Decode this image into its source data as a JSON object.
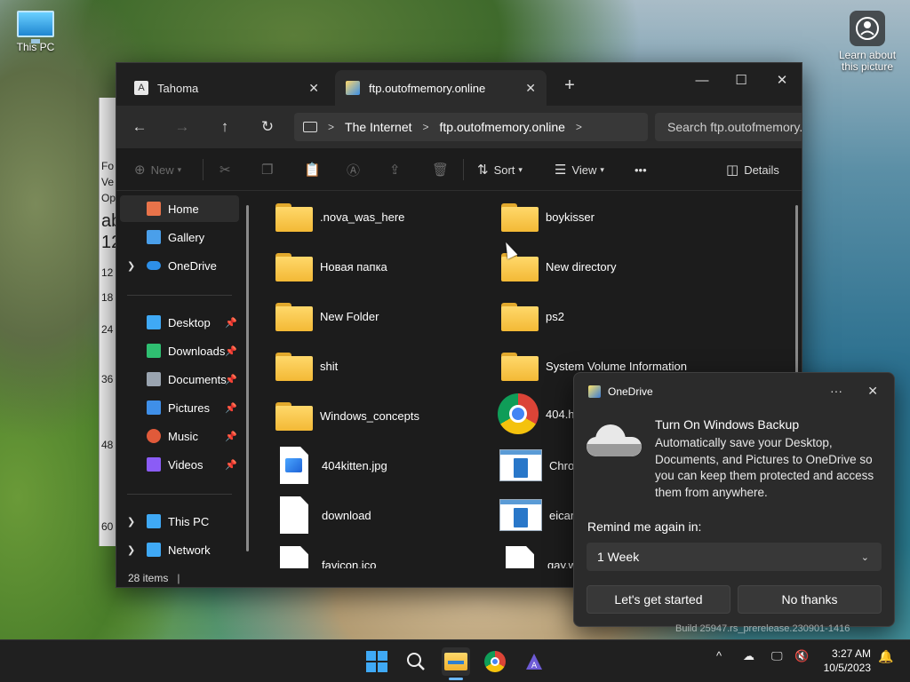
{
  "desktop": {
    "icons": [
      {
        "label": "This PC"
      },
      {
        "label": "Learn about this picture"
      }
    ]
  },
  "background_window": {
    "lines": [
      "Fo",
      "Ve",
      "Op",
      "ab",
      "12",
      "12",
      "18",
      "24",
      "36",
      "48",
      "60"
    ]
  },
  "explorer": {
    "tabs": [
      {
        "label": "Tahoma",
        "active": false
      },
      {
        "label": "ftp.outofmemory.online",
        "active": true
      }
    ],
    "new_tab": "+",
    "window_controls": {
      "minimize": "—",
      "maximize": "☐",
      "close": "✕"
    },
    "nav": {
      "back": "←",
      "forward": "→",
      "up": "↑",
      "refresh": "↻"
    },
    "address": {
      "crumbs": [
        "The Internet",
        "ftp.outofmemory.online"
      ],
      "sep": ">"
    },
    "search": {
      "placeholder": "Search ftp.outofmemory."
    },
    "toolbar": {
      "new_label": "New",
      "sort_label": "Sort",
      "view_label": "View",
      "more_label": "•••",
      "details_label": "Details"
    },
    "sidebar": {
      "items": [
        {
          "label": "Home",
          "icon": "home-icon",
          "color": "#e8734a",
          "selected": true
        },
        {
          "label": "Gallery",
          "icon": "gallery-icon",
          "color": "#4a9fea"
        },
        {
          "label": "OneDrive",
          "icon": "onedrive-icon",
          "color": "#2d8fe8",
          "expand": true
        },
        {
          "label": "Desktop",
          "icon": "desktop-icon",
          "color": "#3fa9f5",
          "pinned": true
        },
        {
          "label": "Downloads",
          "icon": "download-icon",
          "color": "#2fbf71",
          "pinned": true
        },
        {
          "label": "Documents",
          "icon": "documents-icon",
          "color": "#9aa4b0",
          "pinned": true
        },
        {
          "label": "Pictures",
          "icon": "pictures-icon",
          "color": "#3f8fe8",
          "pinned": true
        },
        {
          "label": "Music",
          "icon": "music-icon",
          "color": "#e05a3a",
          "pinned": true
        },
        {
          "label": "Videos",
          "icon": "videos-icon",
          "color": "#8b5cf6",
          "pinned": true
        },
        {
          "label": "This PC",
          "icon": "this-pc-icon",
          "color": "#3fa9f5",
          "expand": true
        },
        {
          "label": "Network",
          "icon": "network-icon",
          "color": "#3fa9f5",
          "expand": true
        }
      ]
    },
    "files": [
      {
        "name": ".nova_was_here",
        "type": "folder"
      },
      {
        "name": "boykisser",
        "type": "folder"
      },
      {
        "name": "Новая папка",
        "type": "folder"
      },
      {
        "name": "New directory",
        "type": "folder"
      },
      {
        "name": "New Folder",
        "type": "folder"
      },
      {
        "name": "ps2",
        "type": "folder"
      },
      {
        "name": "shit",
        "type": "folder"
      },
      {
        "name": "System Volume Information",
        "type": "folder"
      },
      {
        "name": "Windows_concepts",
        "type": "folder"
      },
      {
        "name": "404.ht",
        "type": "html"
      },
      {
        "name": "404kitten.jpg",
        "type": "image"
      },
      {
        "name": "Chron",
        "type": "app"
      },
      {
        "name": "download",
        "type": "doc"
      },
      {
        "name": "eicar.c",
        "type": "app"
      },
      {
        "name": "favicon.ico",
        "type": "doc"
      },
      {
        "name": "gay.w",
        "type": "media"
      }
    ],
    "status": {
      "count": "28 items"
    }
  },
  "toast": {
    "app": "OneDrive",
    "more": "···",
    "close": "✕",
    "title": "Turn On Windows Backup",
    "body": "Automatically save your Desktop, Documents, and Pictures to OneDrive so you can keep them protected and access them from anywhere.",
    "remind_label": "Remind me again in:",
    "remind_value": "1 Week",
    "primary_button": "Let's get started",
    "secondary_button": "No thanks"
  },
  "watermark": "Build 25947.rs_prerelease.230901-1416",
  "taskbar": {
    "time": "3:27 AM",
    "date": "10/5/2023",
    "tray_chevron": "^"
  }
}
